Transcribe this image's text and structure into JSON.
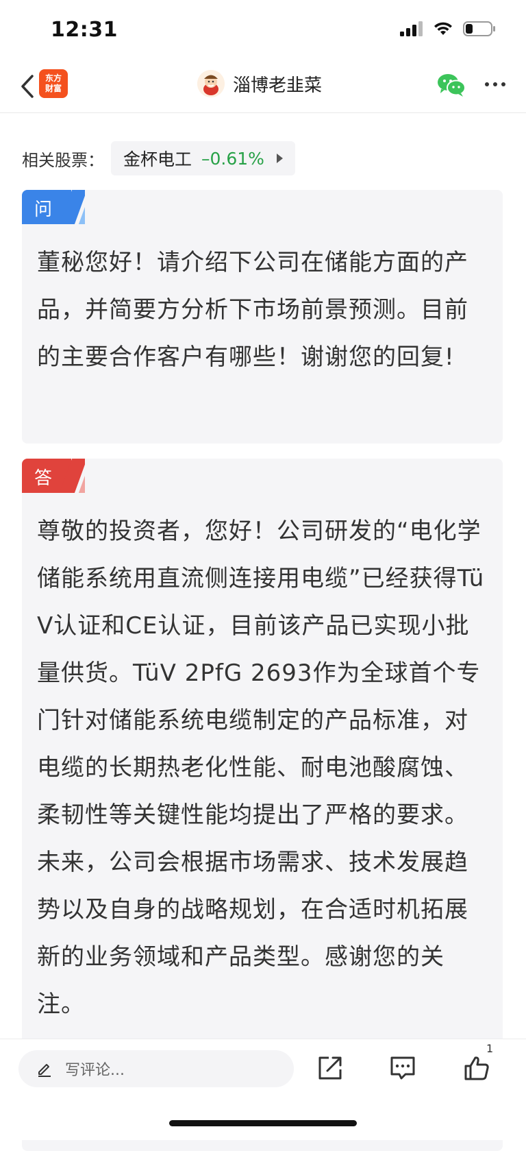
{
  "status_bar": {
    "time": "12:31",
    "battery_level": 0.25
  },
  "nav": {
    "app_logo_line1": "东方",
    "app_logo_line2": "财富",
    "author_name": "淄博老韭菜",
    "icons": {
      "back": "chevron-left-icon",
      "share": "wechat-icon",
      "more": "more-dots-icon"
    }
  },
  "related_stocks": {
    "label": "相关股票：",
    "stock": {
      "name": "金杯电工",
      "change": "–0.61%",
      "change_color": "#27a147"
    }
  },
  "question": {
    "tag": "问",
    "tag_color": "#3a84e8",
    "text": "董秘您好！请介绍下公司在储能方面的产品，并简要方分析下市场前景预测。目前的主要合作客户有哪些！谢谢您的回复!"
  },
  "answer": {
    "tag": "答",
    "tag_color": "#e0433c",
    "text": "尊敬的投资者，您好！公司研发的“电化学储能系统用直流侧连接用电缆”已经获得TüV认证和CE认证，目前该产品已实现小批量供货。TüV 2PfG 2693作为全球首个专门针对储能系统电缆制定的产品标准，对电缆的长期热老化性能、耐电池酸腐蚀、柔韧性等关键性能均提出了严格的要求。未来，公司会根据市场需求、技术发展趋势以及自身的战略规划，在合适时机拓展新的业务领域和产品类型。感谢您的关注。"
  },
  "bottom_bar": {
    "comment_placeholder": "写评论...",
    "like_count": "1",
    "icons": {
      "pen": "pencil-icon",
      "share": "share-out-icon",
      "comment": "comment-icon",
      "like": "thumbs-up-icon"
    }
  }
}
